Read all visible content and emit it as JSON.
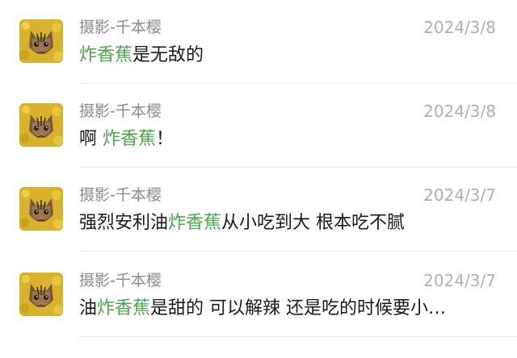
{
  "comments": [
    {
      "author": "摄影-千本樱",
      "date": "2024/3/8",
      "avatar_icon": "cat-face-avatar",
      "text_before": "",
      "highlight": "炸香蕉",
      "text_after": "是无敌的"
    },
    {
      "author": "摄影-千本樱",
      "date": "2024/3/8",
      "avatar_icon": "cat-face-avatar",
      "text_before": "啊 ",
      "highlight": "炸香蕉",
      "text_after": "！"
    },
    {
      "author": "摄影-千本樱",
      "date": "2024/3/7",
      "avatar_icon": "cat-face-avatar",
      "text_before": "强烈安利油",
      "highlight": "炸香蕉",
      "text_after": "从小吃到大 根本吃不腻"
    },
    {
      "author": "摄影-千本樱",
      "date": "2024/3/7",
      "avatar_icon": "cat-face-avatar",
      "text_before": "油",
      "highlight": "炸香蕉",
      "text_after": "是甜的 可以解辣 还是吃的时候要小…"
    }
  ],
  "colors": {
    "highlight": "#4aa84a",
    "author": "#8a8a8a",
    "date": "#b0b0b0",
    "text": "#1a1a1a",
    "divider": "#ececec"
  }
}
